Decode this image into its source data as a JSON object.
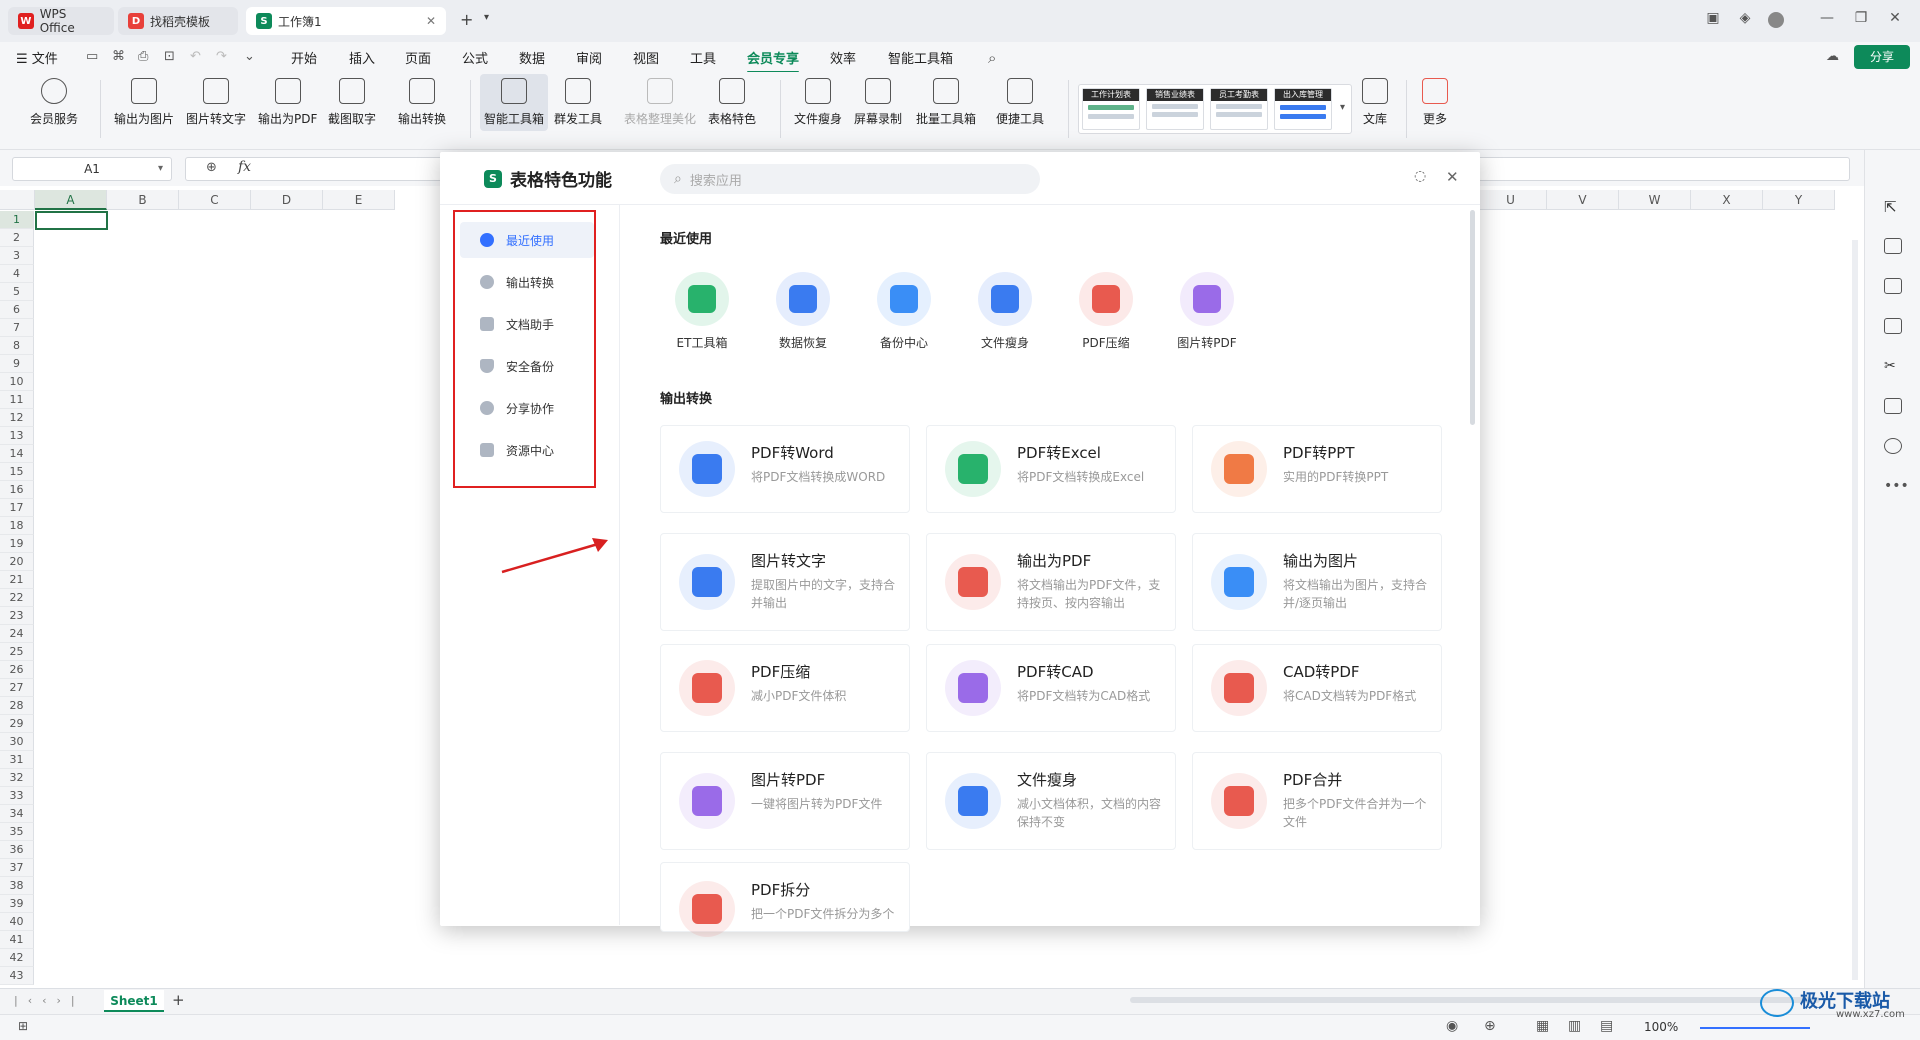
{
  "tabs": [
    {
      "label": "WPS Office",
      "icon": "wps-logo-icon"
    },
    {
      "label": "找稻壳模板",
      "icon": "docer-icon"
    },
    {
      "label": "工作簿1",
      "icon": "spreadsheet-icon"
    }
  ],
  "new_tab": "+",
  "menu": {
    "file": "文件",
    "items": [
      "开始",
      "插入",
      "页面",
      "公式",
      "数据",
      "审阅",
      "视图",
      "工具",
      "会员专享",
      "效率",
      "智能工具箱"
    ],
    "selected": "会员专享",
    "share": "分享"
  },
  "ribbon": {
    "buttons": [
      "会员服务",
      "输出为图片",
      "图片转文字",
      "输出为PDF",
      "截图取字",
      "输出转换",
      "智能工具箱",
      "群发工具",
      "表格整理美化",
      "表格特色",
      "文件瘦身",
      "屏幕录制",
      "批量工具箱",
      "便捷工具"
    ],
    "templates": [
      "工作计划表",
      "销售业绩表",
      "员工考勤表",
      "出入库管理"
    ],
    "library": "文库",
    "more": "更多"
  },
  "formula_bar": {
    "cell_ref": "A1",
    "fx": "fx"
  },
  "columns_left": [
    "A",
    "B",
    "C",
    "D",
    "E"
  ],
  "columns_right": [
    "U",
    "V",
    "W",
    "X",
    "Y"
  ],
  "rows": [
    "1",
    "2",
    "3",
    "4",
    "5",
    "6",
    "7",
    "8",
    "9",
    "10",
    "11",
    "12",
    "13",
    "14",
    "15",
    "16",
    "17",
    "18",
    "19",
    "20",
    "21",
    "22",
    "23",
    "24",
    "25",
    "26",
    "27",
    "28",
    "29",
    "30",
    "31",
    "32",
    "33",
    "34",
    "35",
    "36",
    "37",
    "38",
    "39",
    "40",
    "41",
    "42",
    "43"
  ],
  "sheet_tab": "Sheet1",
  "status": {
    "zoom": "100%"
  },
  "watermark": "极光下载站",
  "watermark_url": "www.xz7.com",
  "dialog": {
    "title": "表格特色功能",
    "search_placeholder": "搜索应用",
    "nav": [
      "最近使用",
      "输出转换",
      "文档助手",
      "安全备份",
      "分享协作",
      "资源中心"
    ],
    "nav_selected": "最近使用",
    "recent_header": "最近使用",
    "recent": [
      {
        "label": "ET工具箱",
        "color": "#28b26c"
      },
      {
        "label": "数据恢复",
        "color": "#3a7bf0"
      },
      {
        "label": "备份中心",
        "color": "#3a8ef6"
      },
      {
        "label": "文件瘦身",
        "color": "#3a7bf0"
      },
      {
        "label": "PDF压缩",
        "color": "#e85a4f"
      },
      {
        "label": "图片转PDF",
        "color": "#9a6be8"
      }
    ],
    "convert_header": "输出转换",
    "cards": [
      {
        "title": "PDF转Word",
        "desc": "将PDF文档转换成WORD",
        "color": "#3a7bf0"
      },
      {
        "title": "PDF转Excel",
        "desc": "将PDF文档转换成Excel",
        "color": "#28b26c"
      },
      {
        "title": "PDF转PPT",
        "desc": "实用的PDF转换PPT",
        "color": "#f07a45"
      },
      {
        "title": "图片转文字",
        "desc": "提取图片中的文字，支持合并输出",
        "color": "#3a7bf0"
      },
      {
        "title": "输出为PDF",
        "desc": "将文档输出为PDF文件，支持按页、按内容输出",
        "color": "#e85a4f"
      },
      {
        "title": "输出为图片",
        "desc": "将文档输出为图片，支持合并/逐页输出",
        "color": "#3a8ef6"
      },
      {
        "title": "PDF压缩",
        "desc": "减小PDF文件体积",
        "color": "#e85a4f"
      },
      {
        "title": "PDF转CAD",
        "desc": "将PDF文档转为CAD格式",
        "color": "#9a6be8"
      },
      {
        "title": "CAD转PDF",
        "desc": "将CAD文档转为PDF格式",
        "color": "#e85a4f"
      },
      {
        "title": "图片转PDF",
        "desc": "一键将图片转为PDF文件",
        "color": "#9a6be8"
      },
      {
        "title": "文件瘦身",
        "desc": "减小文档体积，文档的内容保持不变",
        "color": "#3a7bf0"
      },
      {
        "title": "PDF合并",
        "desc": "把多个PDF文件合并为一个文件",
        "color": "#e85a4f"
      },
      {
        "title": "PDF拆分",
        "desc": "把一个PDF文件拆分为多个",
        "color": "#e85a4f"
      }
    ]
  }
}
